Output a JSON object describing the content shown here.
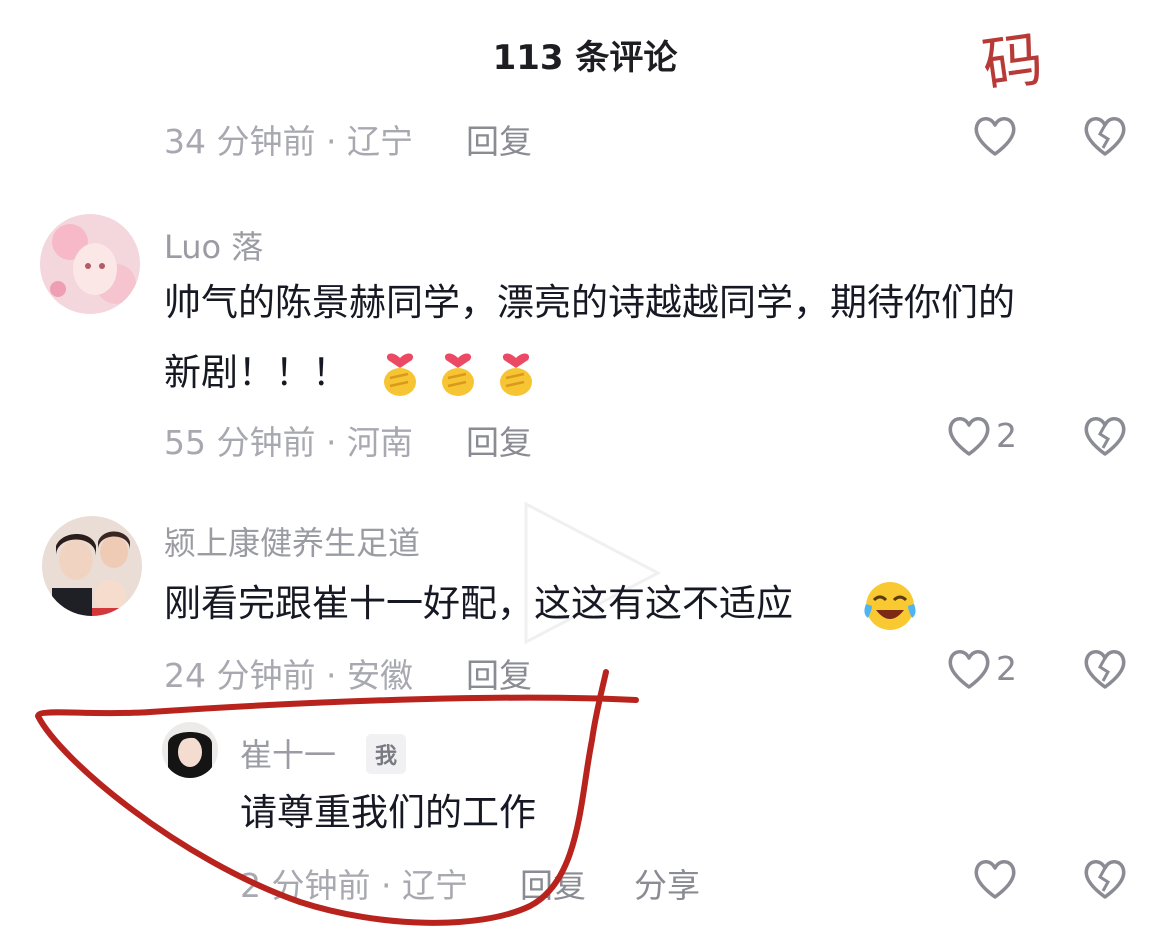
{
  "header": {
    "title": "113 条评论"
  },
  "watermark": {
    "text": "码"
  },
  "comments": [
    {
      "meta": "34 分钟前 · 辽宁",
      "reply": "回复"
    },
    {
      "username": "Luo 落",
      "lines": [
        "帅气的陈景赫同学，漂亮的诗越越同学，期待你们的",
        "新剧！！！"
      ],
      "emojis": [
        "finger-heart-emoji",
        "finger-heart-emoji",
        "finger-heart-emoji"
      ],
      "meta": "55 分钟前 · 河南",
      "reply": "回复",
      "likes": "2"
    },
    {
      "username": "颍上康健养生足道",
      "lines": [
        "刚看完跟崔十一好配，这这有这不适应"
      ],
      "emojis": [
        "laughing-crying-emoji"
      ],
      "meta": "24 分钟前 · 安徽",
      "reply": "回复",
      "likes": "2"
    },
    {
      "username": "崔十一",
      "badge": "我",
      "lines": [
        "请尊重我们的工作"
      ],
      "meta": "2 分钟前 · 辽宁",
      "reply": "回复",
      "share": "分享"
    }
  ],
  "colors": {
    "annotation": "#b8231e",
    "meta": "#a8a9b0",
    "text": "#161823"
  }
}
